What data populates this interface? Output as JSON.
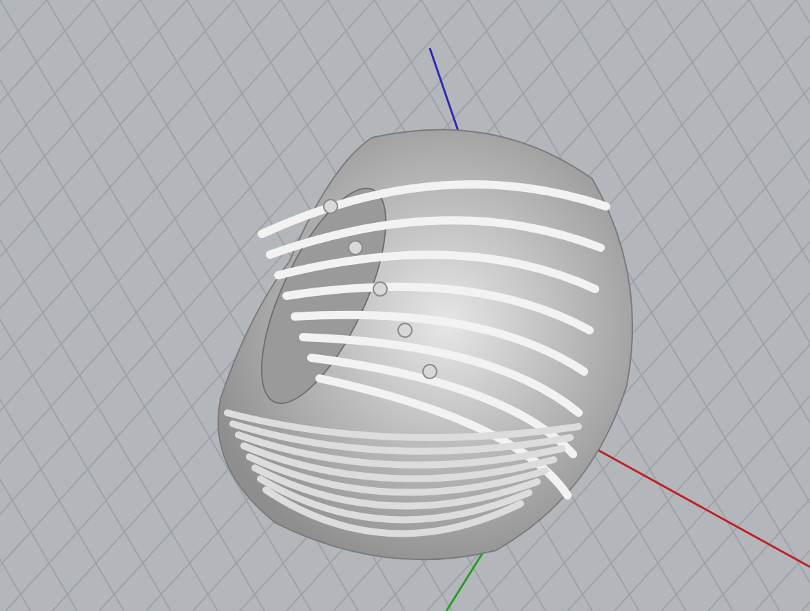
{
  "viewport": {
    "grid": true,
    "axes": true,
    "model": true
  }
}
